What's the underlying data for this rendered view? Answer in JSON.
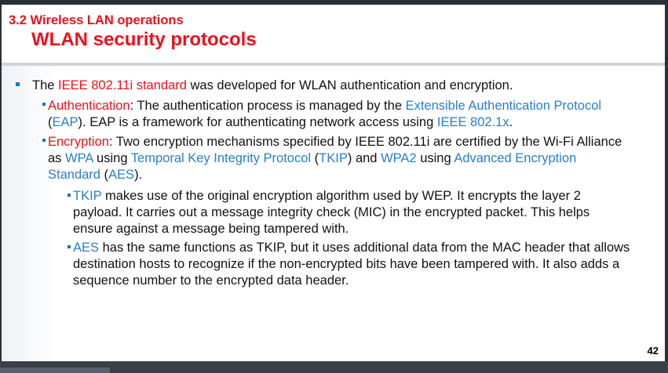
{
  "header": {
    "section": "3.2 Wireless LAN operations",
    "title": "WLAN security protocols"
  },
  "l1": {
    "pre": "The ",
    "term": "IEEE 802.11i standard",
    "post": " was developed for WLAN authentication and encryption."
  },
  "auth": {
    "term": "Authentication",
    "t1": ": The authentication process is managed by the ",
    "eap_full": "Extensible Authentication Protocol",
    "t2": "(",
    "eap": "EAP",
    "t3": "). EAP is a framework for authenticating network access using ",
    "ieee": "IEEE 802.1x",
    "t4": "."
  },
  "enc": {
    "term": "Encryption",
    "t1": ": Two encryption mechanisms specified by IEEE 802.11i are certified by the Wi-Fi Alliance as ",
    "wpa": "WPA",
    "t2": " using ",
    "tkip_full": "Temporal Key Integrity Protocol",
    "t3": " (",
    "tkip": "TKIP",
    "t4": ") and ",
    "wpa2": "WPA2",
    "t5": " using ",
    "aes_full": "Advanced Encryption Standard",
    "t6": " (",
    "aes": "AES",
    "t7": ")."
  },
  "tkip_item": {
    "term": "TKIP",
    "text": " makes use of the original encryption algorithm used by WEP. It encrypts the layer 2 payload. It carries out a message integrity check (MIC) in the encrypted packet. This helps ensure against a message being tampered with."
  },
  "aes_item": {
    "term": "AES",
    "text": " has the same functions as TKIP, but it uses additional data from the MAC header that allows destination hosts to recognize if the non-encrypted bits have been tampered with. It also adds a sequence number to the encrypted data header."
  },
  "footer": {
    "page": "42"
  },
  "colors": {
    "accent_red": "#e8121e",
    "link_blue": "#2a7ec6",
    "bullet_blue": "#1f73c2"
  }
}
